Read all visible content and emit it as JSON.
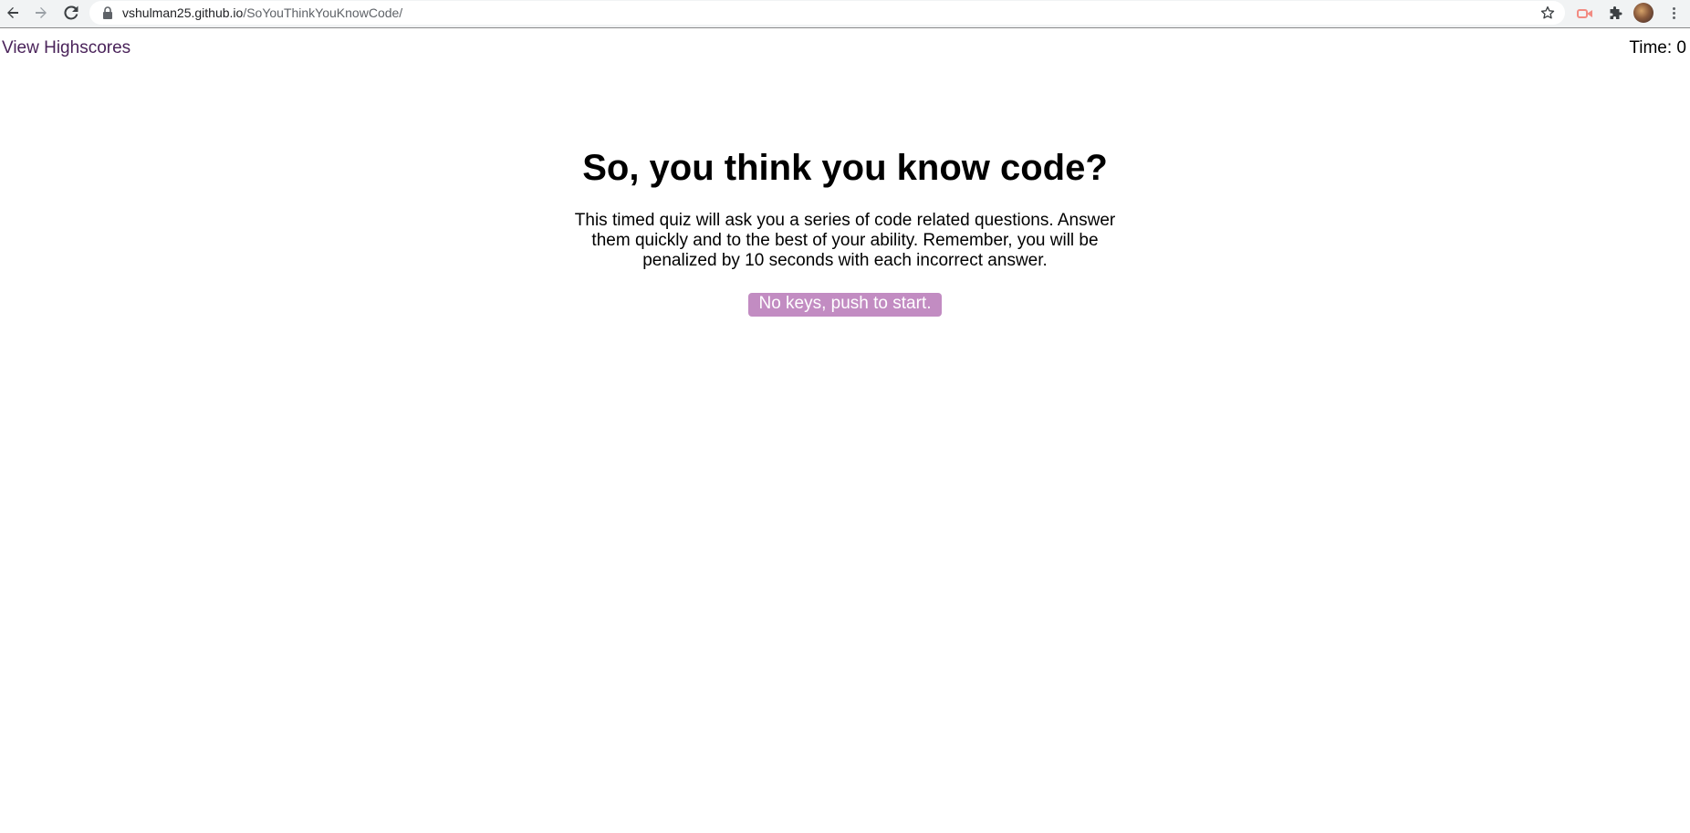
{
  "browser": {
    "url_host": "vshulman25.github.io",
    "url_path": "/SoYouThinkYouKnowCode/",
    "icons": [
      "back-arrow-icon",
      "forward-arrow-icon",
      "reload-icon",
      "lock-icon",
      "star-icon",
      "extension-icon",
      "puzzle-icon",
      "avatar",
      "more-menu-icon"
    ]
  },
  "header": {
    "highscores_link": "View Highscores",
    "timer_label": "Time: ",
    "timer_value": "0"
  },
  "main": {
    "title": "So, you think you know code?",
    "description": "This timed quiz will ask you a series of code related questions. Answer them quickly and to the best of your ability. Remember, you will be penalized by 10 seconds with each incorrect answer.",
    "start_button": "No keys, push to start."
  },
  "colors": {
    "link": "#4a235a",
    "button_bg": "#c28cc2",
    "button_text": "#ffffff"
  }
}
